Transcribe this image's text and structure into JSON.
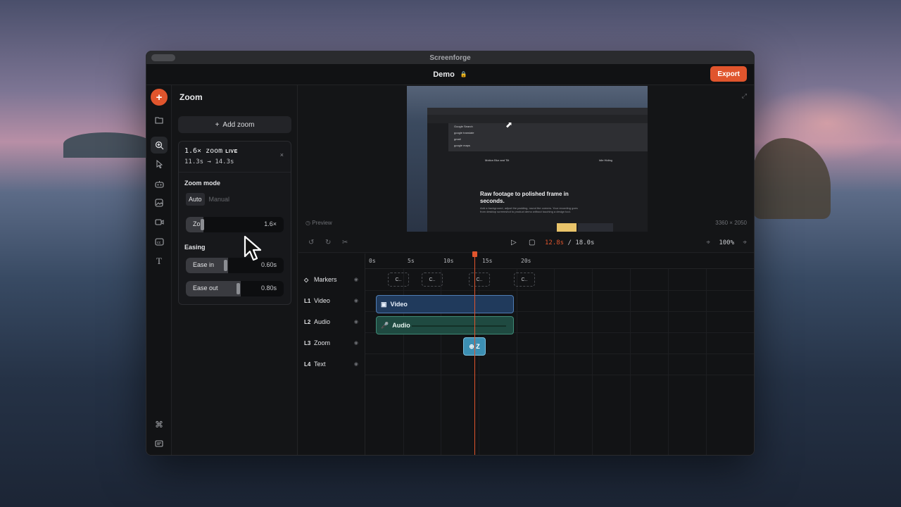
{
  "window": {
    "title": "Screenforge"
  },
  "appbar": {
    "doc_title": "Demo",
    "export_label": "Export"
  },
  "rail": {
    "top": [
      "add",
      "folder",
      "zoom",
      "cursor",
      "camera",
      "image",
      "video",
      "captions",
      "text"
    ],
    "bottom": [
      "command",
      "chat"
    ]
  },
  "panel": {
    "title": "Zoom",
    "add_label": "Add zoom",
    "add_icon": "+",
    "card": {
      "zoom_value": "1.6× zoom",
      "live_badge": "LIVE",
      "time_range": "11.3s → 14.3s",
      "close_icon": "×",
      "mode_label": "Zoom mode",
      "modes": [
        "Auto",
        "Manual"
      ],
      "selected_mode": "Auto",
      "zoom_slider": {
        "label": "Zo",
        "value": "1.6×"
      },
      "easing_label": "Easing",
      "ease_in": {
        "label": "Ease in",
        "value": "0.60s"
      },
      "ease_out": {
        "label": "Ease out",
        "value": "0.80s"
      }
    }
  },
  "preview": {
    "label": "Preview",
    "resolution": "3360 × 2050",
    "headline": "Raw footage to polished frame in seconds.",
    "body": "Add a background, adjust the padding, round the corners. Your recording goes from desktop screenshot to product demo without touching a design tool.",
    "col1_title": "Motion Blur and Tilt",
    "col2_title": "Idle Hiding",
    "dropdown": [
      "Google Search",
      "google translate",
      "gmail",
      "google maps"
    ]
  },
  "toolbar": {
    "current_time": "12.8s",
    "separator": " / ",
    "total_time": "18.0s",
    "zoom_level": "100%"
  },
  "timeline": {
    "ticks": [
      "0s",
      "5s",
      "10s",
      "15s",
      "20s"
    ],
    "tracks": [
      {
        "id": "",
        "name": "Markers"
      },
      {
        "id": "L1",
        "name": "Video"
      },
      {
        "id": "L2",
        "name": "Audio"
      },
      {
        "id": "L3",
        "name": "Zoom"
      },
      {
        "id": "L4",
        "name": "Text"
      }
    ],
    "marker_label": "C..",
    "video_clip_label": "Video",
    "audio_clip_label": "Audio",
    "zoom_clip_label": "Z"
  },
  "colors": {
    "accent": "#e0552d",
    "video": "#4f7db4",
    "audio": "#3e8a76",
    "zoom": "#3c8fb3"
  }
}
